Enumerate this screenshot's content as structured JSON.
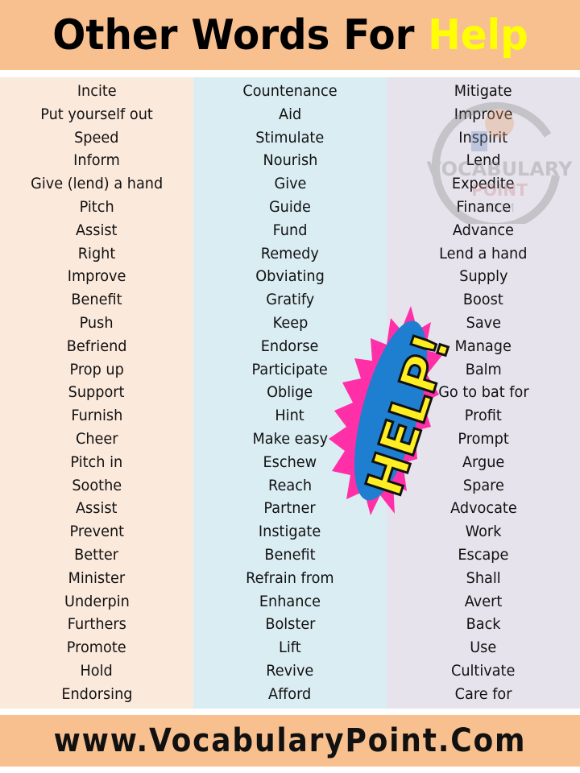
{
  "header": {
    "title_prefix": "Other Words For ",
    "title_highlight": "Help"
  },
  "columns": [
    {
      "words": [
        "Incite",
        "Put yourself out",
        "Speed",
        "Inform",
        "Give (lend) a hand",
        "Pitch",
        "Assist",
        "Right",
        "Improve",
        "Benefit",
        "Push",
        "Befriend",
        "Prop up",
        "Support",
        "Furnish",
        "Cheer",
        "Pitch in",
        "Soothe",
        "Assist",
        "Prevent",
        "Better",
        "Minister",
        "Underpin",
        "Furthers",
        "Promote",
        "Hold",
        "Endorsing"
      ]
    },
    {
      "words": [
        "Countenance",
        "Aid",
        "Stimulate",
        "Nourish",
        "Give",
        "Guide",
        "Fund",
        "Remedy",
        "Obviating",
        "Gratify",
        "Keep",
        "Endorse",
        "Participate",
        "Oblige",
        "Hint",
        "Make easy",
        "Eschew",
        "Reach",
        "Partner",
        "Instigate",
        "Benefit",
        "Refrain from",
        "Enhance",
        "Bolster",
        "Lift",
        "Revive",
        "Afford"
      ]
    },
    {
      "words": [
        "Mitigate",
        "Improve",
        "Inspirit",
        "Lend",
        "Expedite",
        "Finance",
        "Advance",
        "Lend a hand",
        "Supply",
        "Boost",
        "Save",
        "Manage",
        "Balm",
        "Go to bat for",
        "Profit",
        "Prompt",
        "Argue",
        "Spare",
        "Advocate",
        "Work",
        "Escape",
        "Shall",
        "Avert",
        "Back",
        "Use",
        "Cultivate",
        "Care for"
      ]
    }
  ],
  "watermark": {
    "line1": "VOCABULARY",
    "line2": "POINT",
    "line3": ".COM"
  },
  "burst": {
    "text": "HELP!"
  },
  "footer": {
    "url": "www.VocabularyPoint.Com"
  },
  "colors": {
    "banner": "#f9c08f",
    "highlight": "#ffff00",
    "col1_bg": "#fbe9dc",
    "col2_bg": "#daedf3",
    "col3_bg": "#e6e3ec",
    "burst_pink": "#ff2fa8",
    "burst_blue": "#1e7fd0",
    "burst_yellow": "#ffee22"
  }
}
